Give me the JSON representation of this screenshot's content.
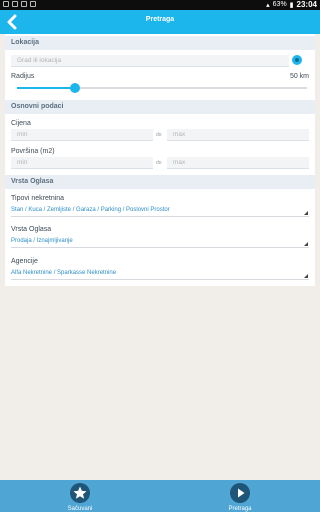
{
  "status": {
    "battery": "63%",
    "time": "23:04"
  },
  "header": {
    "title": "Pretraga"
  },
  "lokacija": {
    "header": "Lokacija",
    "placeholder": "Grad ili lokacija",
    "radius_label": "Radijus",
    "radius_value": "50 km",
    "radius_fraction": 0.2
  },
  "osnovni": {
    "header": "Osnovni podaci",
    "cijena_label": "Cijena",
    "povrsina_label": "Površina (m2)",
    "min_placeholder": "min",
    "do_label": "do",
    "max_placeholder": "max"
  },
  "vrsta": {
    "header": "Vrsta Oglasa",
    "tipovi_label": "Tipovi nekretnina",
    "tipovi_value": "Stan / Kuca / Zemljiste / Garaza / Parking / Poslovni Prostor",
    "vrsta_label": "Vrsta Oglasa",
    "vrsta_value": "Prodaja / Iznajmljivanje",
    "agencije_label": "Agencije",
    "agencije_value": "Alfa Nekretnine / Sparkasse Nekretnine"
  },
  "bottom": {
    "left_label": "Sačuvani",
    "right_label": "Pretraga"
  },
  "colors": {
    "accent": "#1cb6ec",
    "bottombar": "#4fa6d4",
    "link": "#2d8ec6"
  }
}
